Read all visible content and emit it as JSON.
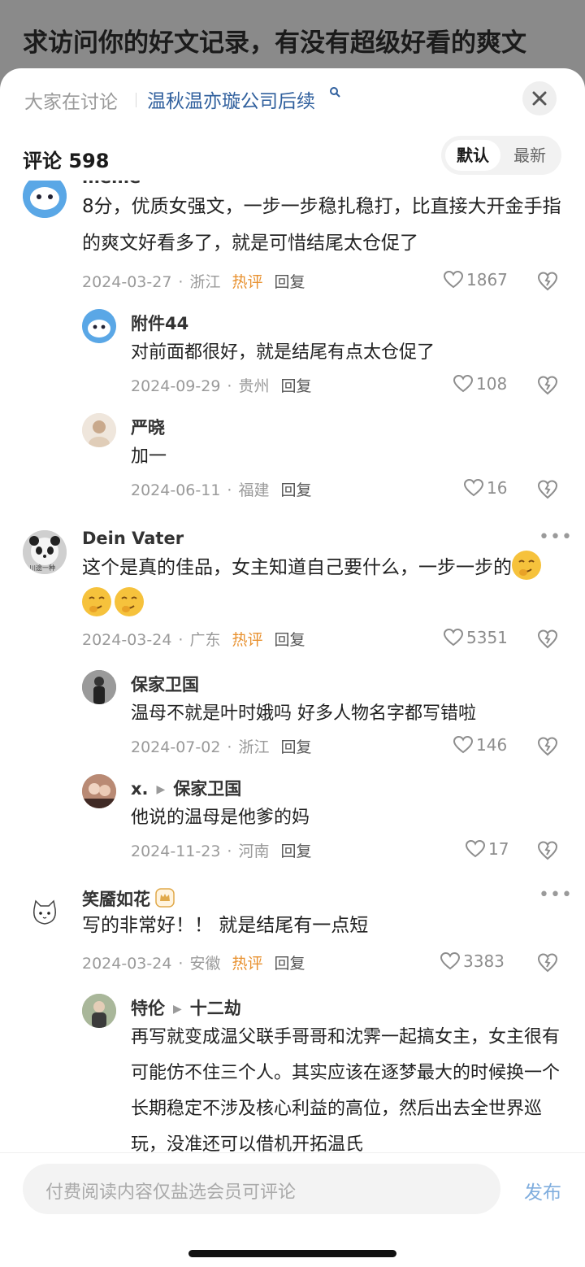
{
  "background_title": "求访问你的好文记录，有没有超级好看的爽文",
  "header": {
    "label": "大家在讨论",
    "topic": "温秋温亦璇公司后续",
    "comment_count": "评论 598",
    "sort_default": "默认",
    "sort_latest": "最新"
  },
  "comments": [
    {
      "user": "meme",
      "text": "8分，优质女强文，一步一步稳扎稳打，比直接大开金手指的爽文好看多了，就是可惜结尾太仓促了",
      "date": "2024-03-27",
      "region": "浙江",
      "hot": "热评",
      "reply": "回复",
      "likes": "1867",
      "replies": [
        {
          "user": "附件44",
          "text": "对前面都很好，就是结尾有点太仓促了",
          "date": "2024-09-29",
          "region": "贵州",
          "reply": "回复",
          "likes": "108"
        },
        {
          "user": "严晓",
          "text": "加一",
          "date": "2024-06-11",
          "region": "福建",
          "reply": "回复",
          "likes": "16"
        }
      ]
    },
    {
      "user": "Dein Vater",
      "avatar_caption": "川途一种",
      "text": "这个是真的佳品，女主知道自己要什么，一步一步的",
      "emoji": "smirk-emoji",
      "date": "2024-03-24",
      "region": "广东",
      "hot": "热评",
      "reply": "回复",
      "likes": "5351",
      "replies": [
        {
          "user": "保家卫国",
          "text": "温母不就是叶时娥吗 好多人物名字都写错啦",
          "date": "2024-07-02",
          "region": "浙江",
          "reply": "回复",
          "likes": "146"
        },
        {
          "user": "x.",
          "reply_to": "保家卫国",
          "text": "他说的温母是他爹的妈",
          "date": "2024-11-23",
          "region": "河南",
          "reply": "回复",
          "likes": "17"
        }
      ]
    },
    {
      "user": "笑靥如花",
      "text": "写的非常好！！ 就是结尾有一点短",
      "date": "2024-03-24",
      "region": "安徽",
      "hot": "热评",
      "reply": "回复",
      "likes": "3383",
      "replies": [
        {
          "user": "特伦",
          "reply_to": "十二劫",
          "text": "再写就变成温父联手哥哥和沈霁一起搞女主，女主很有可能仿不住三个人。其实应该在逐梦最大的时候换一个长期稳定不涉及核心利益的高位，然后出去全世界巡玩，没准还可以借机开拓温氏"
        }
      ]
    }
  ],
  "footer": {
    "input_placeholder": "付费阅读内容仅盐选会员可评论",
    "publish": "发布"
  },
  "colors": {
    "accent_link": "#2f5f9d",
    "hot": "#e8912f",
    "publish": "#80aede"
  }
}
